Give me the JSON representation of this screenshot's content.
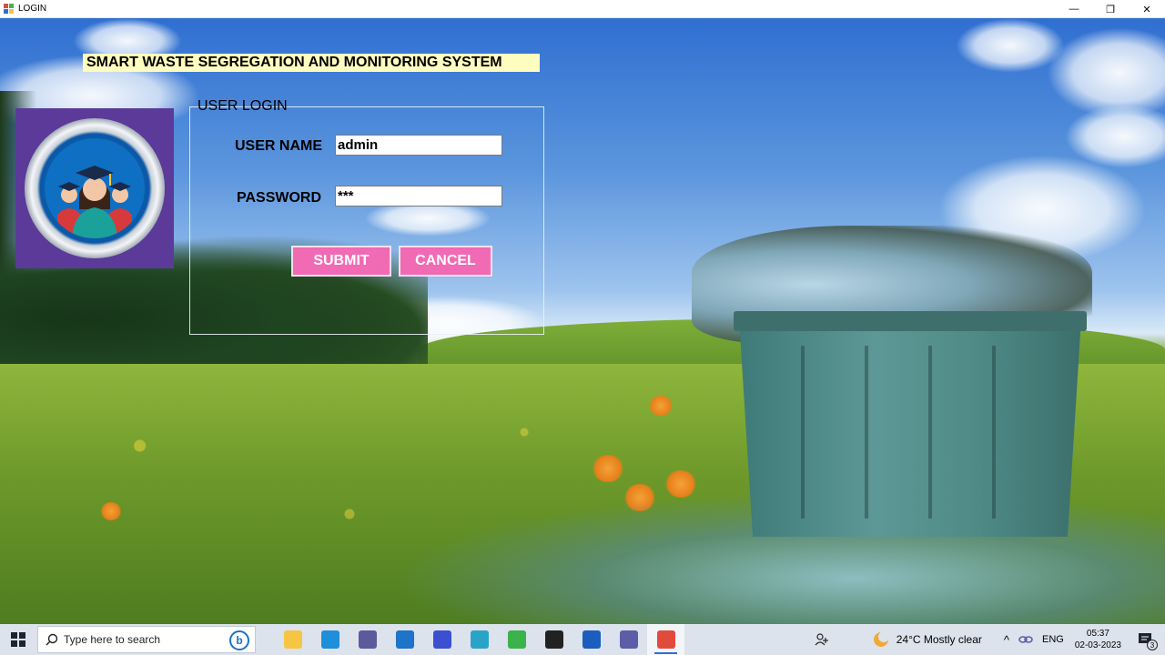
{
  "window": {
    "title": "LOGIN",
    "controls": {
      "minimize": "—",
      "maximize": "❐",
      "close": "✕"
    }
  },
  "banner": {
    "title": "SMART WASTE SEGREGATION AND MONITORING SYSTEM"
  },
  "login": {
    "group_title": "USER LOGIN",
    "username_label": "USER NAME",
    "username_value": "admin",
    "password_label": "PASSWORD",
    "password_value": "***",
    "submit_label": "SUBMIT",
    "cancel_label": "CANCEL"
  },
  "colors": {
    "banner_bg": "#fffcbf",
    "button_bg": "#f06ab4",
    "avatar_bg": "#5b3a9a"
  },
  "taskbar": {
    "search_placeholder": "Type here to search",
    "apps": [
      {
        "name": "file-explorer-icon",
        "color": "#f6c543"
      },
      {
        "name": "edge-icon",
        "color": "#1e8fd8"
      },
      {
        "name": "paint-icon",
        "color": "#5a5a9c"
      },
      {
        "name": "mail-icon",
        "color": "#1e74c8"
      },
      {
        "name": "sketch-icon",
        "color": "#3d4fd1"
      },
      {
        "name": "pencil-app-icon",
        "color": "#2aa3c9"
      },
      {
        "name": "green-app-icon",
        "color": "#3bb34a"
      },
      {
        "name": "sticky-notes-icon",
        "color": "#222222"
      },
      {
        "name": "word-icon",
        "color": "#1b5ebd"
      },
      {
        "name": "link-app-icon",
        "color": "#5b5ea6"
      },
      {
        "name": "login-app-icon",
        "color": "#e24b3c"
      }
    ],
    "weather": "24°C  Mostly clear",
    "language": "ENG",
    "time": "05:37",
    "date": "02-03-2023",
    "notifications": "3"
  }
}
